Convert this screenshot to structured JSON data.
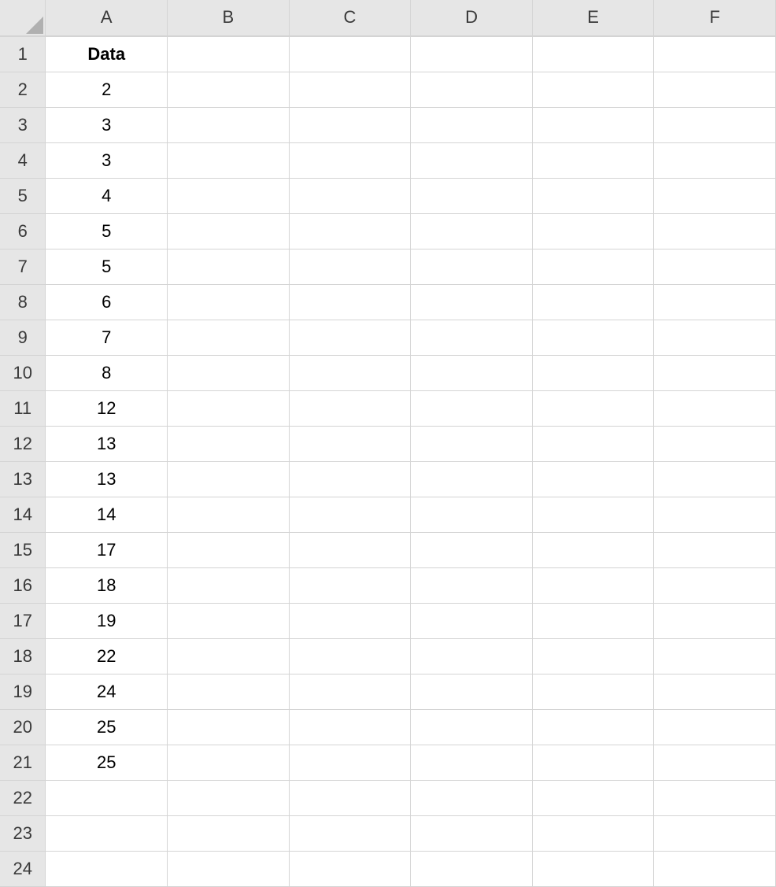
{
  "columns": [
    "A",
    "B",
    "C",
    "D",
    "E",
    "F"
  ],
  "rowCount": 24,
  "cells": {
    "A1": {
      "value": "Data",
      "bold": true
    },
    "A2": {
      "value": "2"
    },
    "A3": {
      "value": "3"
    },
    "A4": {
      "value": "3"
    },
    "A5": {
      "value": "4"
    },
    "A6": {
      "value": "5"
    },
    "A7": {
      "value": "5"
    },
    "A8": {
      "value": "6"
    },
    "A9": {
      "value": "7"
    },
    "A10": {
      "value": "8"
    },
    "A11": {
      "value": "12"
    },
    "A12": {
      "value": "13"
    },
    "A13": {
      "value": "13"
    },
    "A14": {
      "value": "14"
    },
    "A15": {
      "value": "17"
    },
    "A16": {
      "value": "18"
    },
    "A17": {
      "value": "19"
    },
    "A18": {
      "value": "22"
    },
    "A19": {
      "value": "24"
    },
    "A20": {
      "value": "25"
    },
    "A21": {
      "value": "25"
    }
  }
}
